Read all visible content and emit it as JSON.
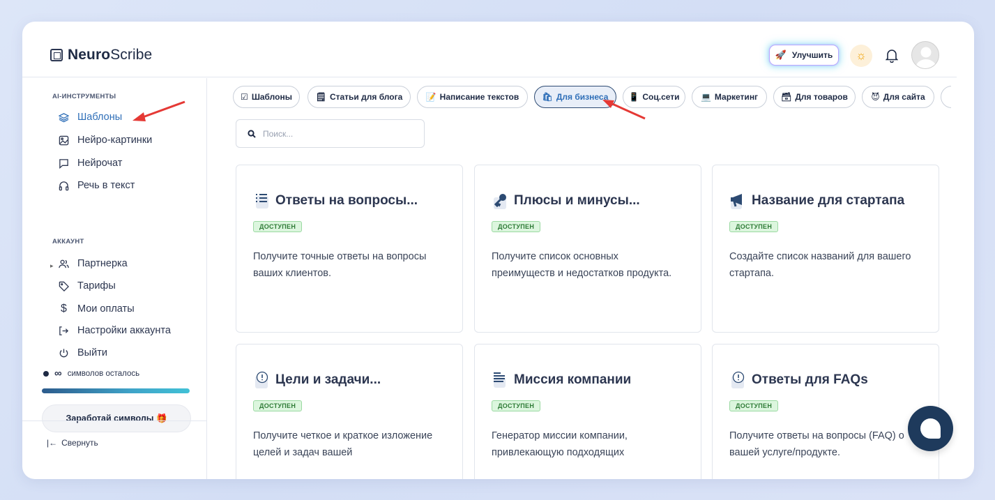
{
  "brand": {
    "name_bold": "Neuro",
    "name_rest": "Scribe"
  },
  "header": {
    "upgrade_label": "Улучшить"
  },
  "sidebar": {
    "ai_section_title": "AI-ИНСТРУМЕНТЫ",
    "ai_items": [
      {
        "label": "Шаблоны",
        "icon": "layers-icon",
        "active": true
      },
      {
        "label": "Нейро-картинки",
        "icon": "image-icon"
      },
      {
        "label": "Нейрочат",
        "icon": "chat-icon"
      },
      {
        "label": "Речь в текст",
        "icon": "headphones-icon"
      }
    ],
    "account_section_title": "АККАУНТ",
    "account_items": [
      {
        "label": "Партнерка",
        "icon": "users-icon"
      },
      {
        "label": "Тарифы",
        "icon": "tag-icon"
      },
      {
        "label": "Мои оплаты",
        "icon": "dollar-icon"
      },
      {
        "label": "Настройки аккаунта",
        "icon": "login-icon"
      },
      {
        "label": "Выйти",
        "icon": "power-icon"
      }
    ],
    "symbols_value": "∞",
    "symbols_text": "символов осталось",
    "earn_label": "Заработай символы 🎁",
    "collapse_label": "Свернуть",
    "collapse_glyph": "|←"
  },
  "chips": [
    {
      "icon": "☑",
      "label": "Шаблоны"
    },
    {
      "icon": "🗒",
      "label": "Статьи для блога"
    },
    {
      "icon": "📝",
      "label": "Написание текстов"
    },
    {
      "icon": "🛍",
      "label": "Для бизнеса",
      "active": true
    },
    {
      "icon": "📱",
      "label": "Соц.сети"
    },
    {
      "icon": "💻",
      "label": "Маркетинг"
    },
    {
      "icon": "🗃",
      "label": "Для товаров"
    },
    {
      "icon": "😈",
      "label": "Для сайта"
    }
  ],
  "search": {
    "placeholder": "Поиск..."
  },
  "badge_label": "ДОСТУПЕН",
  "cards": [
    {
      "title": "Ответы на вопросы...",
      "icon": "list-icon",
      "description": "Получите точные ответы на вопросы ваших клиентов."
    },
    {
      "title": "Плюсы и минусы...",
      "icon": "key-icon",
      "description": "Получите список основных преимуществ и недостатков продукта."
    },
    {
      "title": "Название для стартапа",
      "icon": "megaphone-icon",
      "description": "Создайте список названий для вашего стартапа."
    },
    {
      "title": "Цели и задачи...",
      "icon": "alert-icon",
      "description": "Получите четкое и краткое изложение целей и задач вашей"
    },
    {
      "title": "Миссия компании",
      "icon": "text-lines-icon",
      "description": "Генератор миссии компании, привлекающую подходящих"
    },
    {
      "title": "Ответы для FAQs",
      "icon": "alert-icon",
      "description": "Получите ответы на вопросы (FAQ) о вашей услуге/продукте."
    }
  ]
}
